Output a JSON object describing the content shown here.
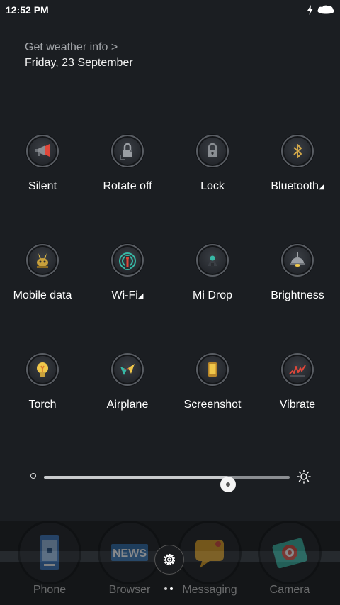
{
  "status_bar": {
    "time": "12:52 PM"
  },
  "header": {
    "weather_link": "Get weather info >",
    "date": "Friday, 23 September"
  },
  "toggles": [
    {
      "label": "Silent",
      "icon": "megaphone-icon"
    },
    {
      "label": "Rotate off",
      "icon": "rotation-lock-icon"
    },
    {
      "label": "Lock",
      "icon": "padlock-icon"
    },
    {
      "label": "Bluetooth",
      "icon": "bluetooth-icon",
      "expandable": true
    },
    {
      "label": "Mobile data",
      "icon": "mobile-data-icon"
    },
    {
      "label": "Wi-Fi",
      "icon": "wifi-icon",
      "expandable": true
    },
    {
      "label": "Mi Drop",
      "icon": "mi-drop-icon"
    },
    {
      "label": "Brightness",
      "icon": "lamp-icon"
    },
    {
      "label": "Torch",
      "icon": "bulb-icon"
    },
    {
      "label": "Airplane",
      "icon": "airplane-icon"
    },
    {
      "label": "Screenshot",
      "icon": "screenshot-icon"
    },
    {
      "label": "Vibrate",
      "icon": "vibrate-icon"
    }
  ],
  "brightness_slider": {
    "level_percent": 75
  },
  "dock": {
    "apps": [
      {
        "label": "Phone",
        "icon": "phone-app-icon"
      },
      {
        "label": "Browser",
        "icon": "browser-app-icon"
      },
      {
        "label": "Messaging",
        "icon": "messaging-app-icon"
      },
      {
        "label": "Camera",
        "icon": "camera-app-icon"
      }
    ],
    "browser_icon_text": "NEWS",
    "pages": 2,
    "active_page": 2
  },
  "colors": {
    "accent_teal": "#37b8a6",
    "accent_yellow": "#f0c74a",
    "accent_red": "#e0473a"
  }
}
